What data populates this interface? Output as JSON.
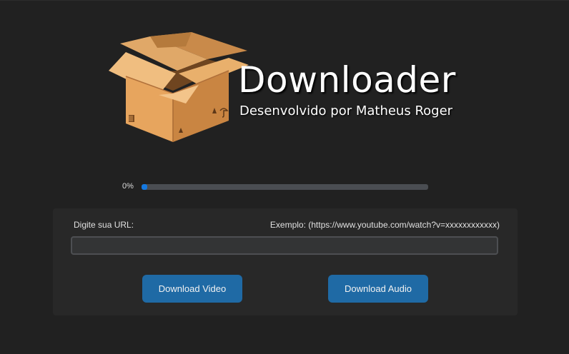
{
  "header": {
    "title": "Downloader",
    "subtitle": "Desenvolvido por Matheus Roger",
    "logo_icon": "cardboard-box-icon"
  },
  "progress": {
    "label": "0%",
    "value": 0.0,
    "fill_color": "#1478e0",
    "track_color": "#4a4d52"
  },
  "form": {
    "url_label": "Digite sua URL:",
    "url_example": "Exemplo: (https://www.youtube.com/watch?v=xxxxxxxxxxxx)",
    "url_value": "",
    "url_placeholder": ""
  },
  "buttons": {
    "video_label": "Download Video",
    "audio_label": "Download Audio",
    "color": "#1f6aa5"
  }
}
